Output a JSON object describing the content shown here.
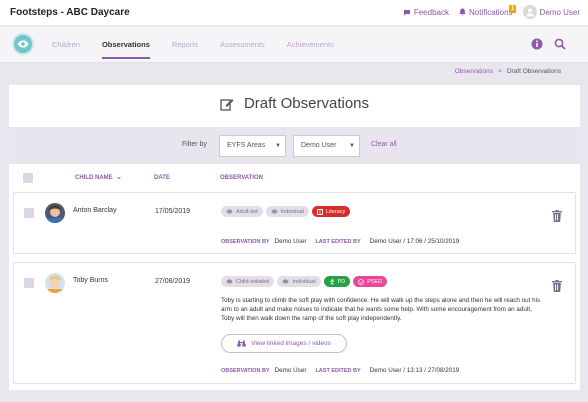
{
  "app": {
    "title": "Footsteps - ABC Daycare"
  },
  "topbar": {
    "feedback": "Feedback",
    "notifications": "Notifications",
    "notification_count": "1",
    "user": "Demo User"
  },
  "nav": {
    "tabs": [
      {
        "label": "Children"
      },
      {
        "label": "Observations"
      },
      {
        "label": "Reports"
      },
      {
        "label": "Assessments"
      },
      {
        "label": "Achievements"
      }
    ]
  },
  "breadcrumb": {
    "parent": "Observations",
    "separator": ">",
    "current": "Draft Observations"
  },
  "page": {
    "title": "Draft Observations"
  },
  "filter": {
    "label": "Filter by",
    "area": "EYFS Areas",
    "user": "Demo User",
    "clear": "Clear all"
  },
  "columns": {
    "child_name": "CHILD NAME",
    "date": "DATE",
    "observation": "OBSERVATION"
  },
  "observations": [
    {
      "child": "Anton Barclay",
      "date": "17/05/2019",
      "tags": [
        "Adult-led",
        "Individual",
        "Literacy"
      ],
      "observation_by_label": "OBSERVATION BY",
      "observation_by": "Demo User",
      "last_edited_label": "LAST EDITED BY",
      "last_edited": "Demo User / 17:06 / 25/10/2019"
    },
    {
      "child": "Toby Burns",
      "date": "27/08/2019",
      "tags": [
        "Child-initiated",
        "Individual",
        "PD",
        "PSED"
      ],
      "text": "Toby is starting to climb the soft play with confidence. He will walk up the steps alone and then he will reach out his arm to an adult and make noises to indicate that he wants some help. With some encouragement from an adult, Toby will then walk down the ramp of the soft play independently.",
      "linked_button": "View linked images / videos",
      "observation_by_label": "OBSERVATION BY",
      "observation_by": "Demo User",
      "last_edited_label": "LAST EDITED BY",
      "last_edited": "Demo User / 13:13 / 27/08/2019"
    }
  ],
  "colors": {
    "accent": "#8d5aa6",
    "teal": "#6fc7c7",
    "literacy": "#d82b2b",
    "pd": "#27a243",
    "psed": "#e64a9a"
  }
}
